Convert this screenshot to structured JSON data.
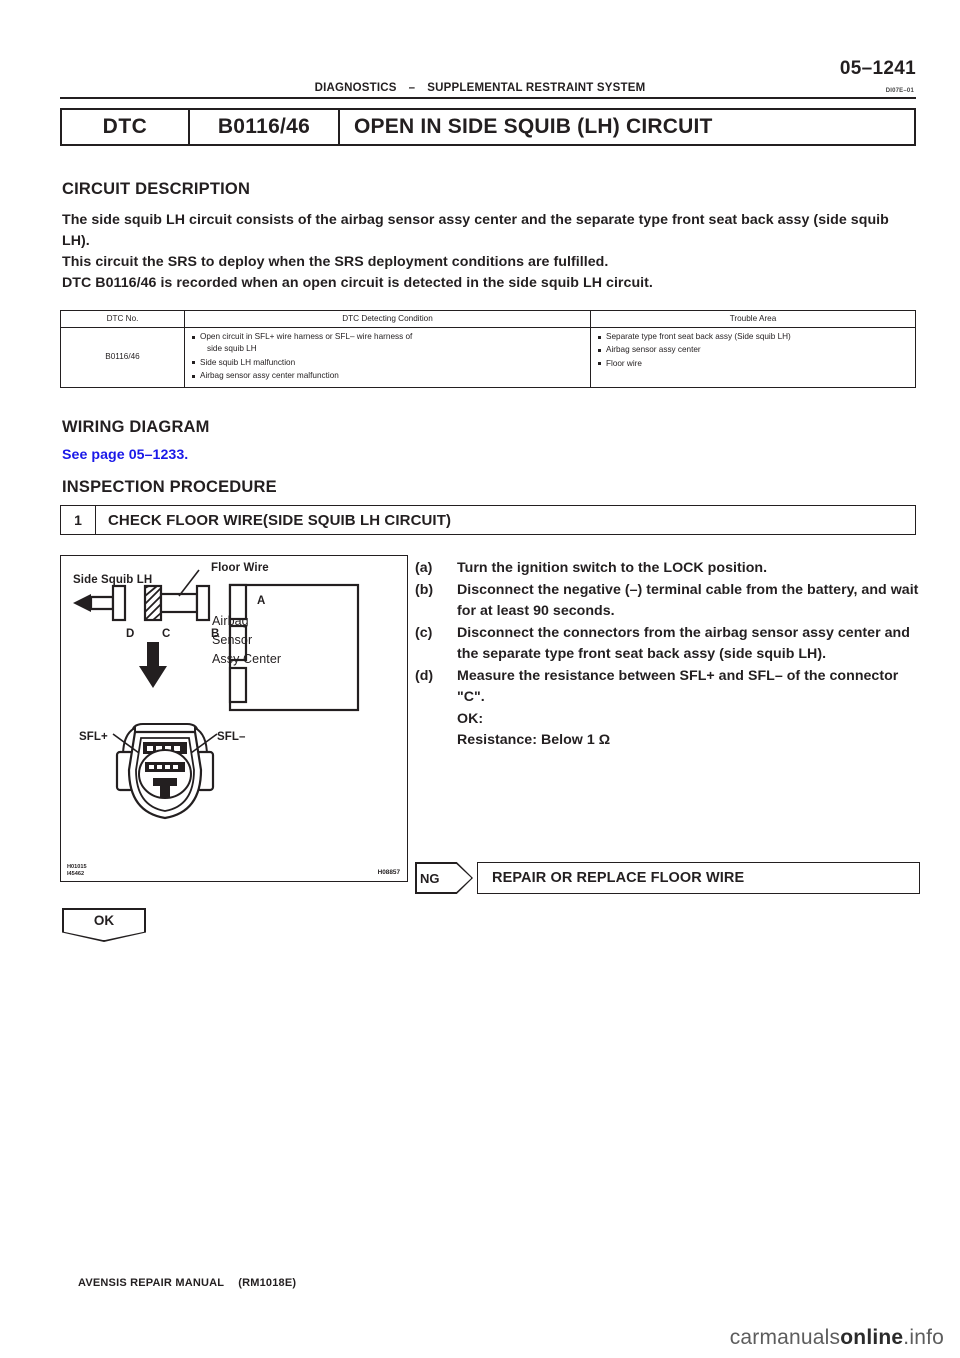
{
  "header": {
    "page_number": "05–1241",
    "breadcrumb_left": "DIAGNOSTICS",
    "breadcrumb_dash": "–",
    "breadcrumb_right": "SUPPLEMENTAL RESTRAINT SYSTEM",
    "ref_code": "DI07E–01"
  },
  "dtc_bar": {
    "label": "DTC",
    "code": "B0116/46",
    "title": "OPEN IN SIDE SQUIB (LH) CIRCUIT"
  },
  "circuit_description": {
    "heading": "CIRCUIT DESCRIPTION",
    "paragraphs": [
      "The side squib LH circuit consists of the airbag sensor assy center and the separate type front seat back assy (side squib LH).",
      "This circuit the SRS to deploy when the SRS deployment conditions are fulfilled.",
      "DTC B0116/46 is recorded when an open circuit is detected in the side squib LH circuit."
    ]
  },
  "dtc_table": {
    "columns": [
      "DTC No.",
      "DTC Detecting Condition",
      "Trouble Area"
    ],
    "rows": [
      {
        "no": "B0116/46",
        "conditions": [
          "Open circuit in SFL+ wire harness or SFL– wire harness of",
          "side squib LH",
          "Side squib LH malfunction",
          "Airbag sensor assy center malfunction"
        ],
        "trouble_area": [
          "Separate type front seat back assy (Side squib LH)",
          "Airbag sensor assy center",
          "Floor wire"
        ]
      }
    ]
  },
  "wiring_diagram": {
    "heading": "WIRING DIAGRAM",
    "see_page": "See page 05–1233."
  },
  "inspection": {
    "heading": "INSPECTION PROCEDURE",
    "step_number": "1",
    "step_title": "CHECK FLOOR WIRE(SIDE SQUIB LH CIRCUIT)"
  },
  "figure": {
    "label_side_squib": "Side Squib LH",
    "label_floor_wire": "Floor Wire",
    "pin_d": "D",
    "pin_c": "C",
    "pin_b": "B",
    "pin_a": "A",
    "sensor_box": "Airbag Sensor Assy Center",
    "terminal_plus": "SFL+",
    "terminal_minus": "SFL–",
    "code_left_1": "H01015",
    "code_left_2": "I45462",
    "code_right": "H08857"
  },
  "instructions": [
    {
      "key": "(a)",
      "text": "Turn the ignition switch to the LOCK position."
    },
    {
      "key": "(b)",
      "text": "Disconnect the negative (–) terminal cable from the battery, and wait for at least 90 seconds."
    },
    {
      "key": "(c)",
      "text": "Disconnect the connectors from the airbag sensor assy center and the separate type front seat back assy (side squib LH)."
    },
    {
      "key": "(d)",
      "text": "Measure the resistance between SFL+ and SFL– of the connector \"C\"."
    }
  ],
  "result": {
    "ok_label": "OK:",
    "spec": "Resistance: Below 1 Ω",
    "ng_tag": "NG",
    "ng_action": "REPAIR OR REPLACE FLOOR WIRE",
    "ok_tag": "OK"
  },
  "footer": {
    "manual": "AVENSIS REPAIR MANUAL",
    "rm_code": "(RM1018E)",
    "watermark_light": "carmanuals",
    "watermark_dark": "online",
    "watermark_tld": ".info"
  }
}
